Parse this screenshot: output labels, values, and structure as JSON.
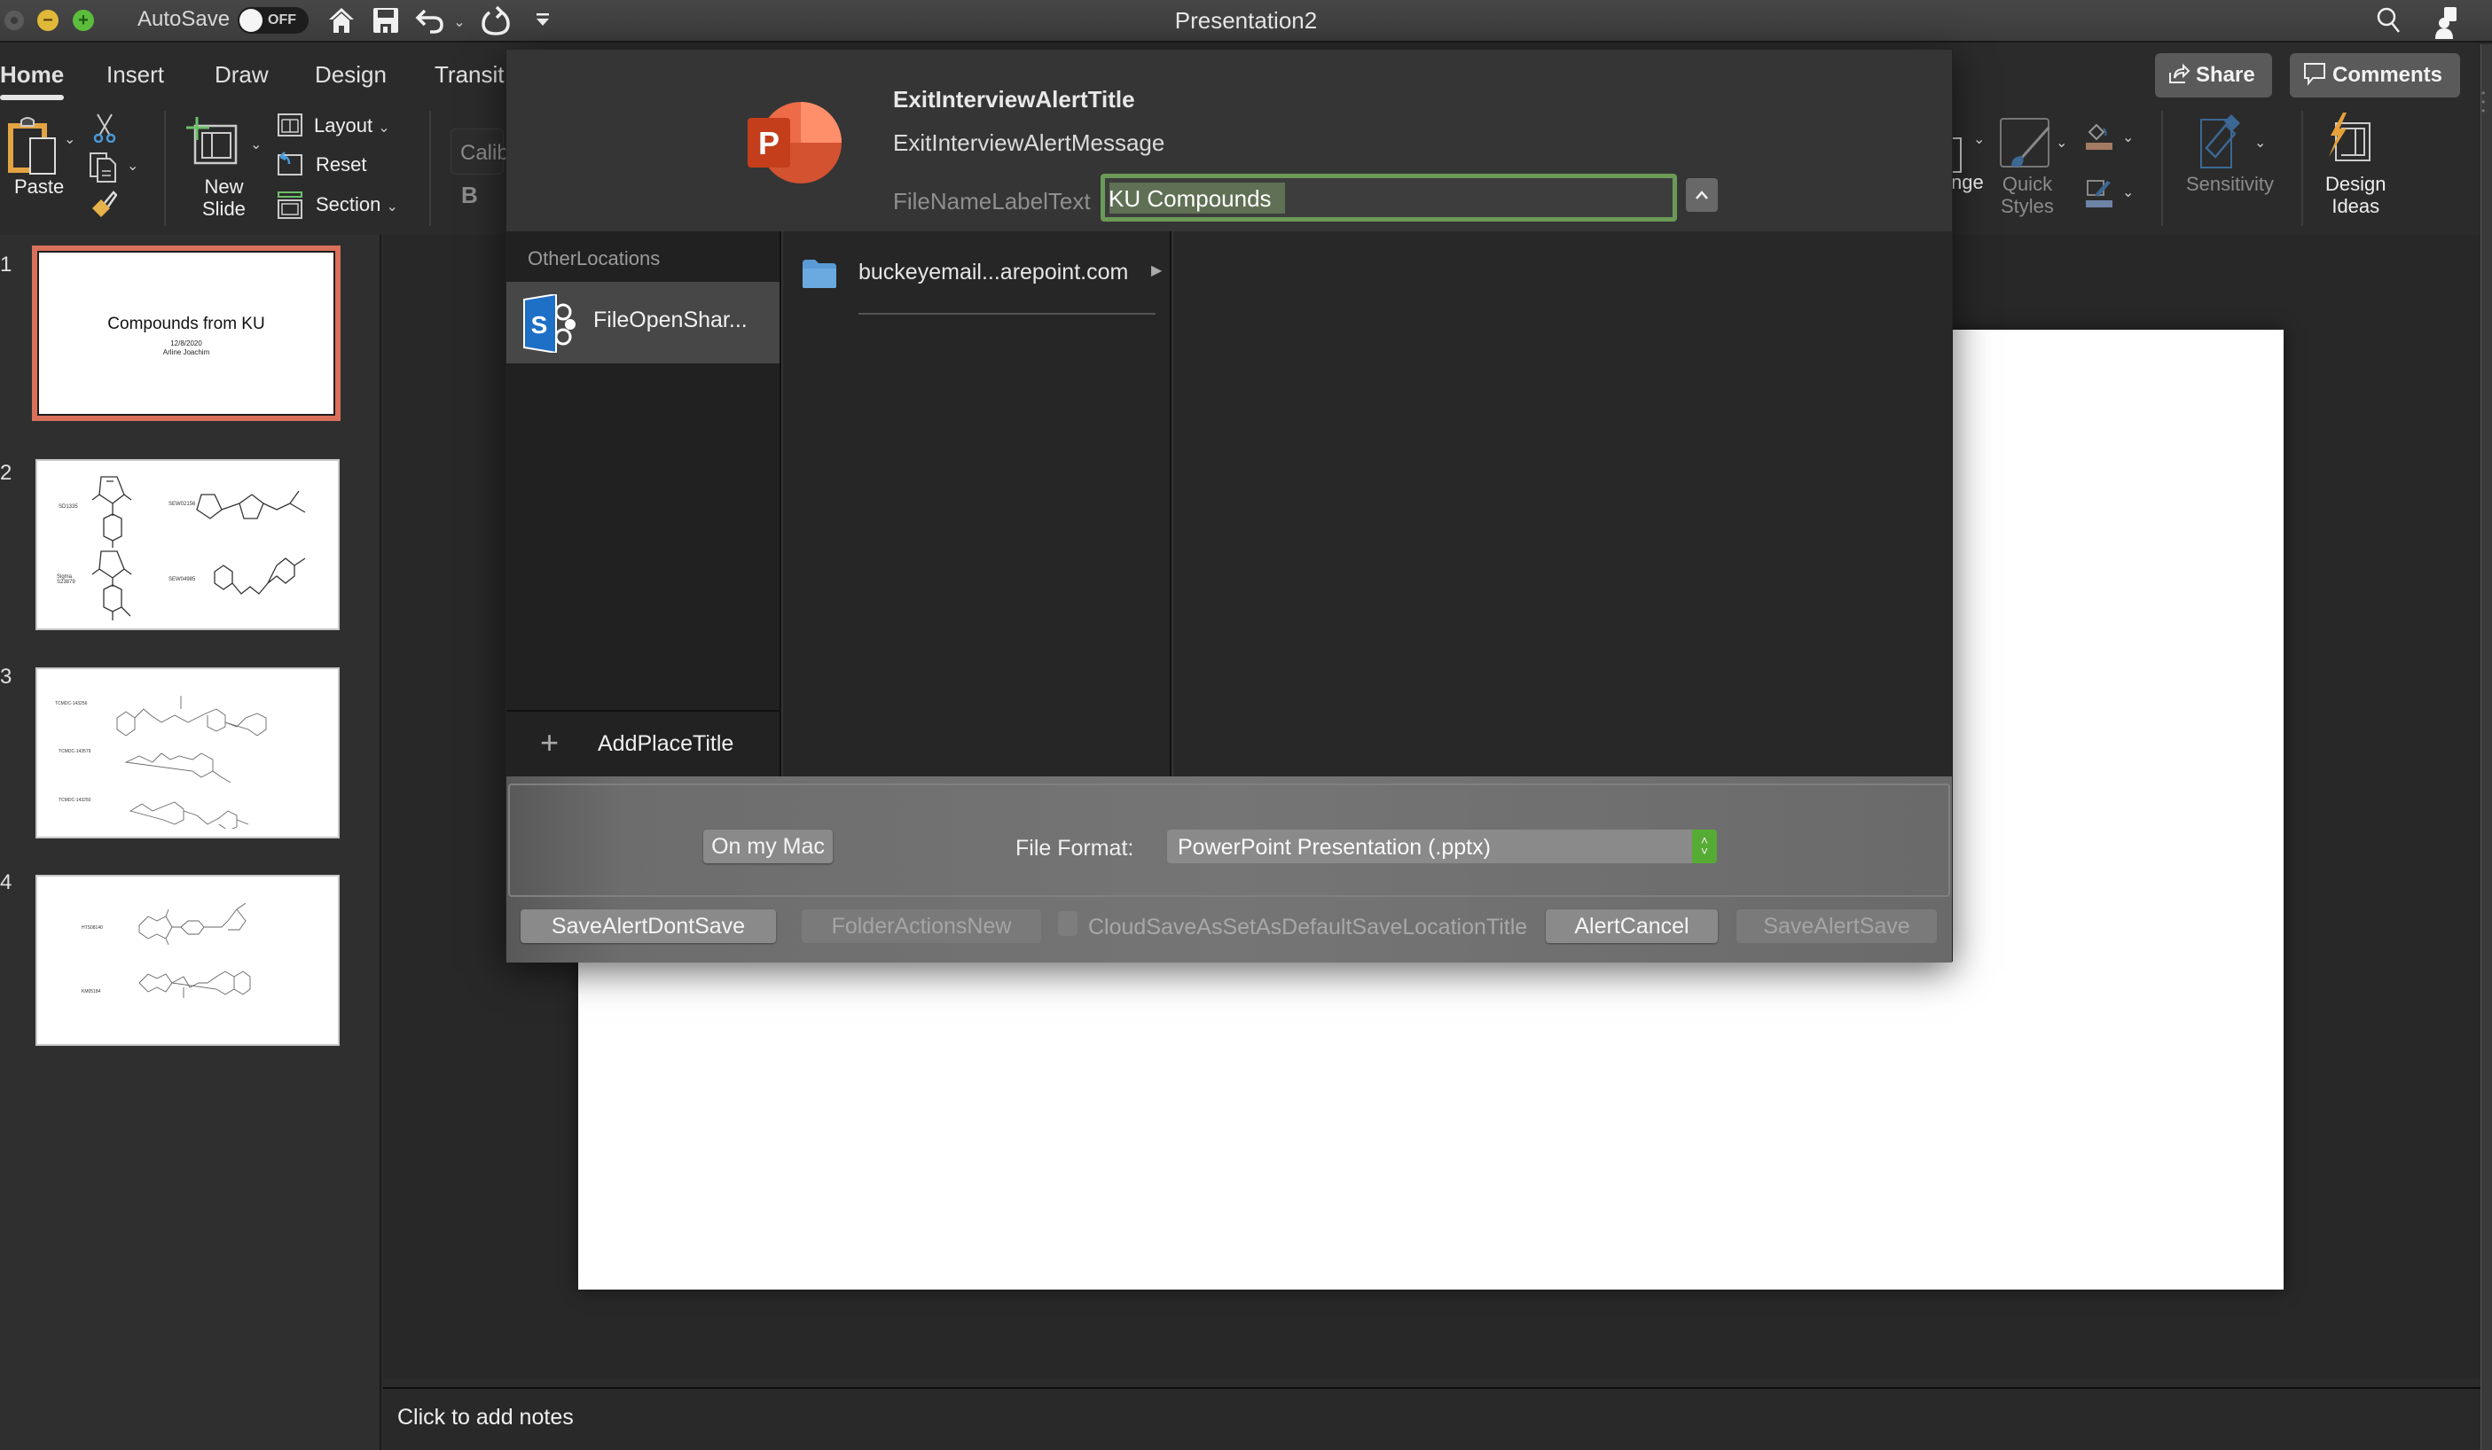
{
  "window": {
    "title": "Presentation2",
    "autosave_label": "AutoSave",
    "autosave_state": "OFF"
  },
  "quick_access": {
    "icons": [
      "home-icon",
      "save-icon",
      "undo-icon",
      "redo-icon",
      "customize-icon"
    ]
  },
  "tabs": [
    {
      "label": "Home",
      "active": true
    },
    {
      "label": "Insert"
    },
    {
      "label": "Draw"
    },
    {
      "label": "Design"
    },
    {
      "label": "Transit"
    }
  ],
  "top_buttons": {
    "share": "Share",
    "comments": "Comments"
  },
  "ribbon": {
    "paste": "Paste",
    "new_slide_line1": "New",
    "new_slide_line2": "Slide",
    "layout": "Layout",
    "reset": "Reset",
    "section": "Section",
    "font_placeholder": "Calib",
    "bold": "B",
    "arrange_partial": "nge",
    "quick_styles_line1": "Quick",
    "quick_styles_line2": "Styles",
    "sensitivity": "Sensitivity",
    "design_ideas_line1": "Design",
    "design_ideas_line2": "Ideas"
  },
  "slides": [
    {
      "number": "1",
      "title": "Compounds from KU",
      "date": "12/8/2020",
      "author": "Arline Joachim",
      "selected": true
    },
    {
      "number": "2",
      "labels": [
        "SD1335",
        "SEW02156",
        "Sigma S23879",
        "SEW04985"
      ]
    },
    {
      "number": "3",
      "labels": [
        "TCMDC-143256",
        "TCMDC-143579",
        "TCMDC-143250"
      ]
    },
    {
      "number": "4",
      "labels": [
        "HTS08140",
        "KM05184"
      ]
    }
  ],
  "notes": {
    "placeholder": "Click to add notes"
  },
  "dialog": {
    "title": "ExitInterviewAlertTitle",
    "message": "ExitInterviewAlertMessage",
    "filename_label": "FileNameLabelText",
    "filename_value": "KU Compounds",
    "locations_header": "OtherLocations",
    "location_item": "FileOpenShar...",
    "add_place": "AddPlaceTitle",
    "folder_item": "buckeyemail...arepoint.com",
    "on_my_mac": "On my Mac",
    "file_format_label": "File Format:",
    "file_format_value": "PowerPoint Presentation (.pptx)",
    "dont_save": "SaveAlertDontSave",
    "new_folder": "FolderActionsNew",
    "default_location_checkbox": "CloudSaveAsSetAsDefaultSaveLocationTitle",
    "cancel": "AlertCancel",
    "save": "SaveAlertSave"
  },
  "colors": {
    "accent_green": "#6b9a57",
    "selected_slide_border": "#d9705a",
    "ppt_orange": "#d35230"
  }
}
